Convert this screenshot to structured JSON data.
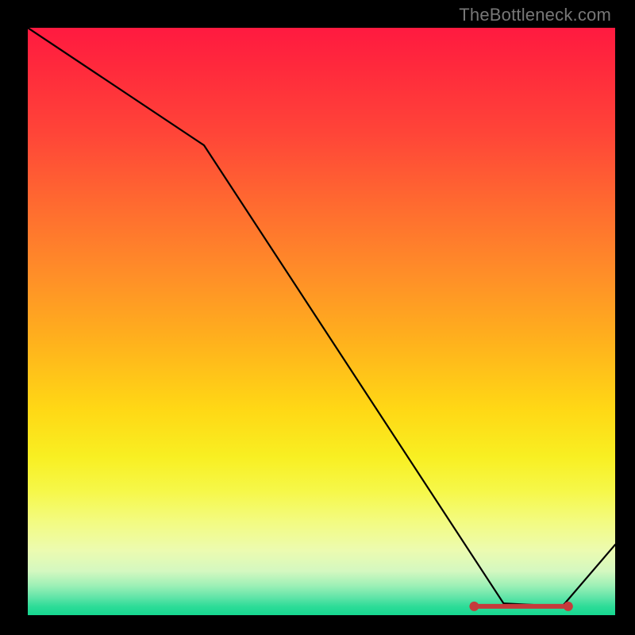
{
  "attribution": "TheBottleneck.com",
  "chart_data": {
    "type": "line",
    "title": "",
    "xlabel": "",
    "ylabel": "",
    "ylim": [
      0,
      100
    ],
    "xlim": [
      0,
      100
    ],
    "x": [
      0,
      30,
      81,
      91,
      100
    ],
    "values": [
      100,
      80,
      2,
      1.5,
      12
    ],
    "optimal_region": {
      "x_start": 76,
      "x_end": 92,
      "y": 1.5
    },
    "background_gradient_stops": [
      {
        "pos": 0,
        "color": "#ff1a40"
      },
      {
        "pos": 50,
        "color": "#ffb01d"
      },
      {
        "pos": 80,
        "color": "#f6f84a"
      },
      {
        "pos": 100,
        "color": "#16d790"
      }
    ]
  }
}
